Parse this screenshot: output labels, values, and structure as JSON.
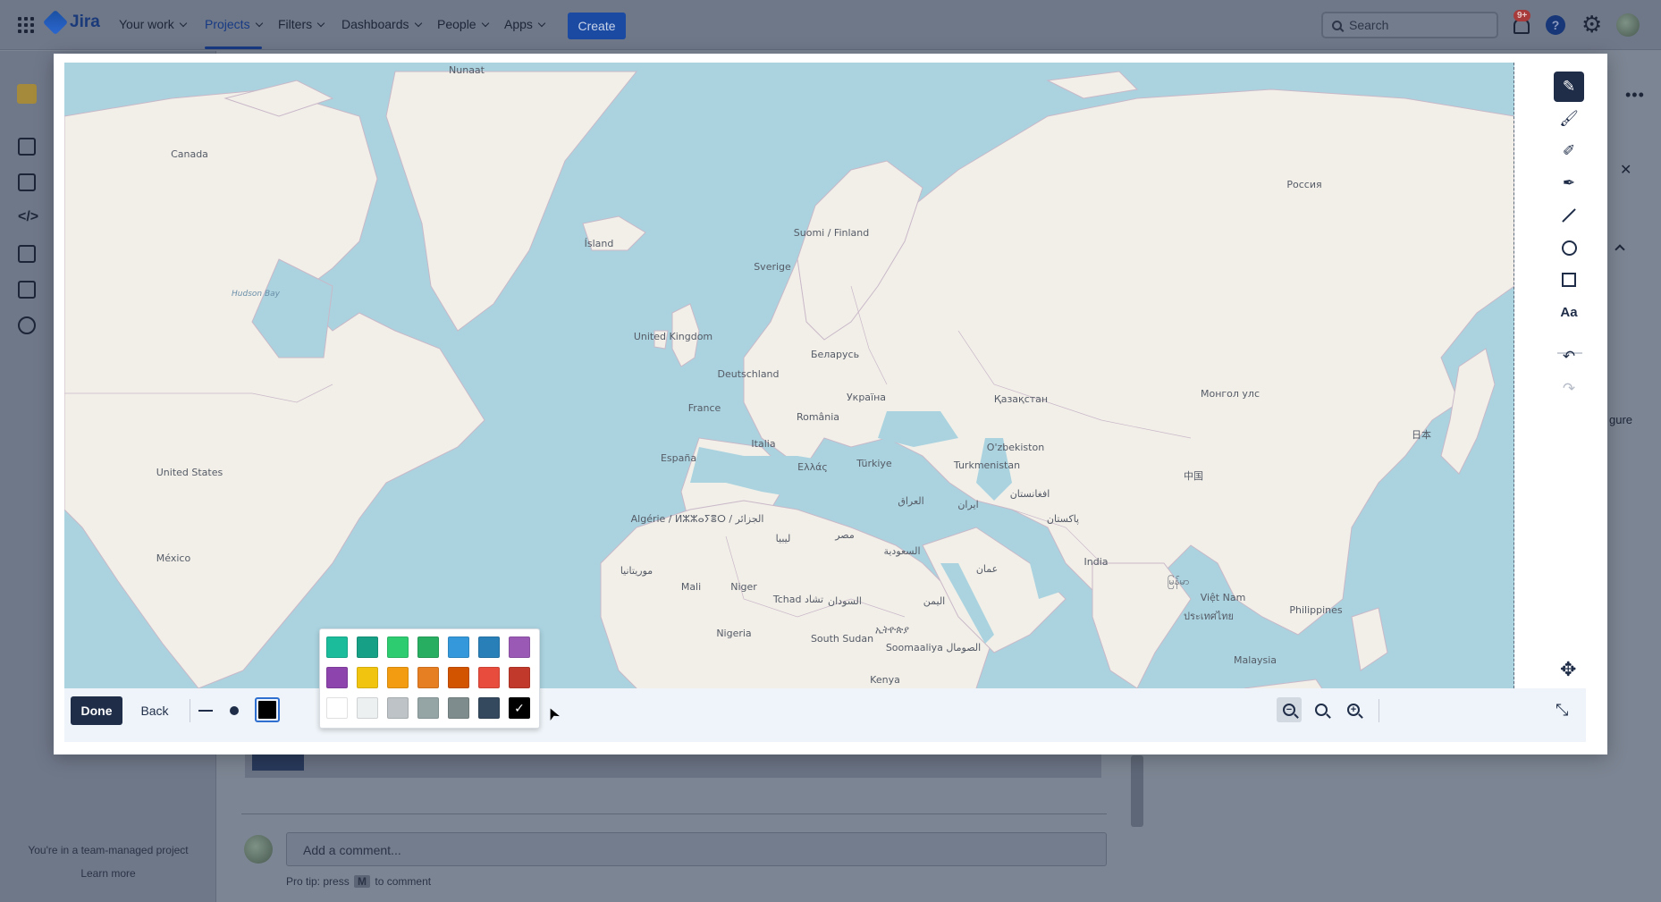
{
  "topnav": {
    "logo": "Jira",
    "items": [
      {
        "label": "Your work"
      },
      {
        "label": "Projects"
      },
      {
        "label": "Filters"
      },
      {
        "label": "Dashboards"
      },
      {
        "label": "People"
      },
      {
        "label": "Apps"
      }
    ],
    "create_label": "Create",
    "search_placeholder": "Search",
    "notification_badge": "9+",
    "help_label": "?"
  },
  "sidebar": {
    "footer_text": "You're in a team-managed project",
    "learn_more": "Learn more"
  },
  "comment": {
    "placeholder": "Add a comment...",
    "protip_prefix": "Pro tip: press",
    "protip_key": "M",
    "protip_suffix": "to comment"
  },
  "background_right": {
    "fragment": "gure"
  },
  "map": {
    "labels": [
      {
        "text": "Nunaat",
        "water": false
      },
      {
        "text": "Canada",
        "water": false
      },
      {
        "text": "Hudson Bay",
        "water": true
      },
      {
        "text": "United States",
        "water": false
      },
      {
        "text": "México",
        "water": false
      },
      {
        "text": "Ísland",
        "water": false
      },
      {
        "text": "Suomi / Finland",
        "water": false
      },
      {
        "text": "Sverige",
        "water": false
      },
      {
        "text": "United Kingdom",
        "water": false
      },
      {
        "text": "Беларусь",
        "water": false
      },
      {
        "text": "Deutschland",
        "water": false
      },
      {
        "text": "Україна",
        "water": false
      },
      {
        "text": "France",
        "water": false
      },
      {
        "text": "România",
        "water": false
      },
      {
        "text": "Italia",
        "water": false
      },
      {
        "text": "España",
        "water": false
      },
      {
        "text": "Ελλάς",
        "water": false
      },
      {
        "text": "Türkiye",
        "water": false
      },
      {
        "text": "Россия",
        "water": false
      },
      {
        "text": "Қазақстан",
        "water": false
      },
      {
        "text": "Монгол улс",
        "water": false
      },
      {
        "text": "O'zbekiston",
        "water": false
      },
      {
        "text": "Turkmenistan",
        "water": false
      },
      {
        "text": "中国",
        "water": false
      },
      {
        "text": "日本",
        "water": false
      },
      {
        "text": "العراق",
        "water": false
      },
      {
        "text": "ایران",
        "water": false
      },
      {
        "text": "افغانستان",
        "water": false
      },
      {
        "text": "پاکستان",
        "water": false
      },
      {
        "text": "Algérie / ⵍⵣⵣⴰⵢⴻⵔ / الجزائر",
        "water": false
      },
      {
        "text": "ليبيا",
        "water": false
      },
      {
        "text": "مصر",
        "water": false
      },
      {
        "text": "السعودية",
        "water": false
      },
      {
        "text": "عمان",
        "water": false
      },
      {
        "text": "India",
        "water": false
      },
      {
        "text": "မြန်မာ",
        "water": false
      },
      {
        "text": "Việt Nam",
        "water": false
      },
      {
        "text": "ประเทศไทย",
        "water": false
      },
      {
        "text": "Philippines",
        "water": false
      },
      {
        "text": "موريتانيا",
        "water": false
      },
      {
        "text": "Mali",
        "water": false
      },
      {
        "text": "Niger",
        "water": false
      },
      {
        "text": "Tchad تشاد",
        "water": false
      },
      {
        "text": "السودان",
        "water": false
      },
      {
        "text": "اليمن",
        "water": false
      },
      {
        "text": "ኢትዮጵያ",
        "water": false
      },
      {
        "text": "Nigeria",
        "water": false
      },
      {
        "text": "South Sudan",
        "water": false
      },
      {
        "text": "Soomaaliya الصومال",
        "water": false
      },
      {
        "text": "Malaysia",
        "water": false
      },
      {
        "text": "Kenya",
        "water": false
      }
    ]
  },
  "editor": {
    "done_label": "Done",
    "back_label": "Back",
    "selected_color": "#000000",
    "tools": [
      {
        "name": "pen",
        "icon": "pencil-icon",
        "active": true
      },
      {
        "name": "brush",
        "icon": "brush-icon"
      },
      {
        "name": "pencil",
        "icon": "pencil-outline-icon"
      },
      {
        "name": "marker",
        "icon": "marker-icon"
      },
      {
        "name": "line",
        "icon": "line-icon"
      },
      {
        "name": "circle",
        "icon": "circle-icon"
      },
      {
        "name": "rectangle",
        "icon": "rectangle-icon"
      },
      {
        "name": "text",
        "icon": "text-icon",
        "label": "Aa"
      },
      {
        "name": "undo",
        "icon": "undo-icon"
      },
      {
        "name": "redo",
        "icon": "redo-icon",
        "disabled": true
      }
    ],
    "palette": [
      "#1abc9c",
      "#16a085",
      "#2ecc71",
      "#27ae60",
      "#3498db",
      "#2980b9",
      "#9b59b6",
      "#8e44ad",
      "#f1c40f",
      "#f39c12",
      "#e67e22",
      "#d35400",
      "#e74c3c",
      "#c0392b",
      "#ffffff",
      "#ecf0f1",
      "#bdc3c7",
      "#95a5a6",
      "#7f8c8d",
      "#34495e",
      "#000000"
    ]
  }
}
